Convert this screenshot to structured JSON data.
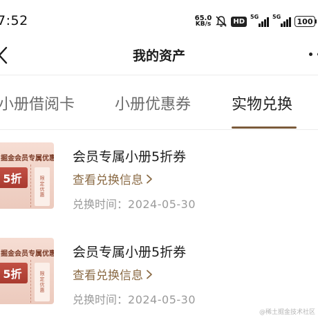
{
  "status_bar": {
    "time": "7:52",
    "net_speed_value": "65.0",
    "net_speed_unit": "KB/s",
    "hd_badge": "HD",
    "signal1_label": "5G",
    "signal2_label": "5G",
    "battery": "100"
  },
  "nav": {
    "title": "我的资产"
  },
  "tabs": [
    {
      "label": "小册借阅卡"
    },
    {
      "label": "小册优惠券"
    },
    {
      "label": "实物兑换"
    }
  ],
  "active_tab_color": "#7a5a3a",
  "items": [
    {
      "coupon_header": "掘金会员专属优惠券",
      "coupon_value": "5折",
      "coupon_side": "限定优惠",
      "title": "会员专属小册5折券",
      "link": "查看兑换信息",
      "time_label": "兑换时间：",
      "time_value": "2024-05-30"
    },
    {
      "coupon_header": "掘金会员专属优惠券",
      "coupon_value": "5折",
      "coupon_side": "限定优惠",
      "title": "会员专属小册5折券",
      "link": "查看兑换信息",
      "time_label": "兑换时间：",
      "time_value": "2024-05-30"
    }
  ],
  "watermark": "@稀土掘金技术社区",
  "link_color": "#8a6a44"
}
